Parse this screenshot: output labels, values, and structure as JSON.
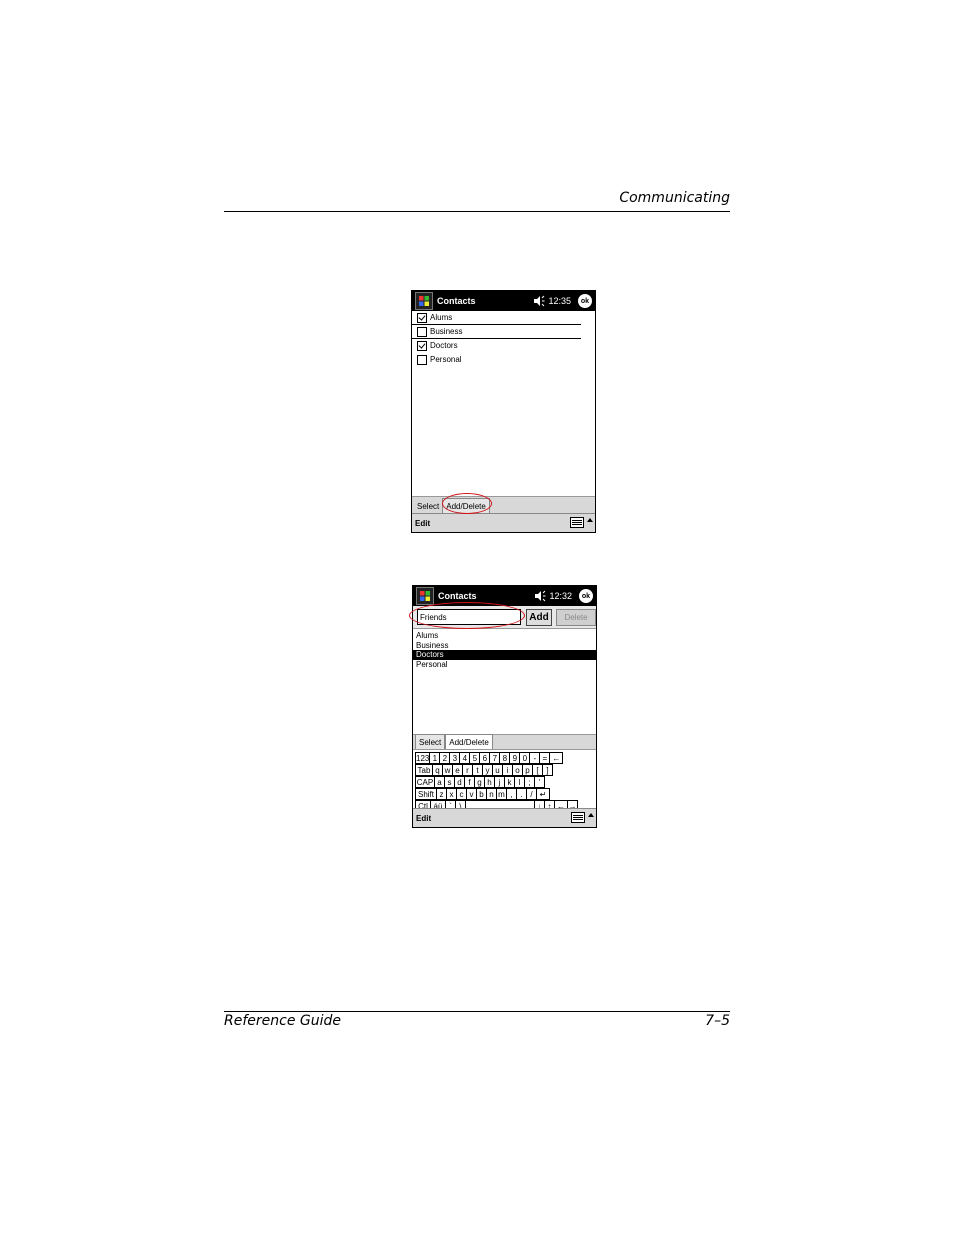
{
  "header": {
    "section": "Communicating"
  },
  "footer": {
    "left": "Reference Guide",
    "right": "7–5"
  },
  "screen1": {
    "title": "Contacts",
    "time": "12:35",
    "ok": "ok",
    "categories": [
      {
        "label": "Alums",
        "checked": true
      },
      {
        "label": "Business",
        "checked": false
      },
      {
        "label": "Doctors",
        "checked": true
      },
      {
        "label": "Personal",
        "checked": false
      }
    ],
    "tabs": {
      "select": "Select",
      "add_delete": "Add/Delete"
    },
    "menu": {
      "edit": "Edit"
    },
    "highlight_color": "#d0141a"
  },
  "screen2": {
    "title": "Contacts",
    "time": "12:32",
    "ok": "ok",
    "input_value": "Friends",
    "add_label": "Add",
    "delete_label": "Delete",
    "list": [
      "Alums",
      "Business",
      "Doctors",
      "Personal"
    ],
    "selected_index": 2,
    "tabs": {
      "select": "Select",
      "add_delete": "Add/Delete"
    },
    "keyboard": [
      [
        "123",
        "1",
        "2",
        "3",
        "4",
        "5",
        "6",
        "7",
        "8",
        "9",
        "0",
        "-",
        "=",
        "←"
      ],
      [
        "Tab",
        "q",
        "w",
        "e",
        "r",
        "t",
        "y",
        "u",
        "i",
        "o",
        "p",
        "[",
        "]"
      ],
      [
        "CAP",
        "a",
        "s",
        "d",
        "f",
        "g",
        "h",
        "j",
        "k",
        "l",
        ";",
        "'"
      ],
      [
        "Shift",
        "z",
        "x",
        "c",
        "v",
        "b",
        "n",
        "m",
        ",",
        ".",
        "/",
        "↵"
      ],
      [
        "Ctl",
        "áü",
        "`",
        "\\",
        " ",
        "↓",
        "↑",
        "←",
        "→"
      ]
    ],
    "menu": {
      "edit": "Edit"
    }
  }
}
